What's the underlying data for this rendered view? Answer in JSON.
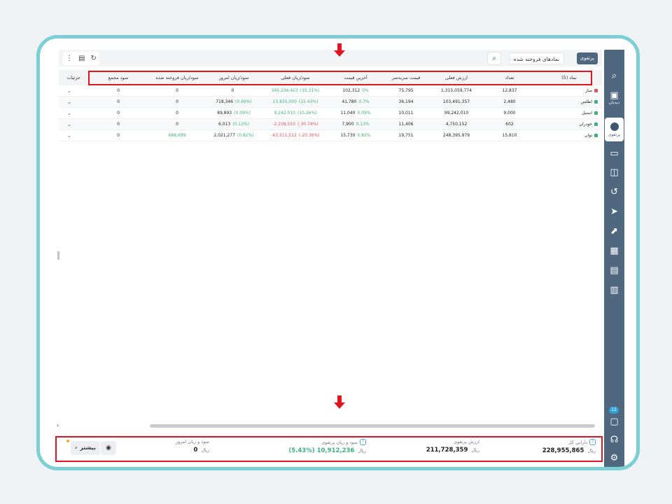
{
  "tabs": {
    "active": "پرتفوی",
    "sold": "نمادهای فروخته شده"
  },
  "sidebar": {
    "items": [
      {
        "icon": "search-icon",
        "label": ""
      },
      {
        "icon": "watchlist-icon",
        "label": "دیدبان"
      },
      {
        "icon": "portfolio-pie-icon",
        "label": "پرتفوی"
      },
      {
        "icon": "opt-icon",
        "label": ""
      },
      {
        "icon": "wallet-icon",
        "label": ""
      },
      {
        "icon": "history-icon",
        "label": ""
      },
      {
        "icon": "send-icon",
        "label": ""
      },
      {
        "icon": "chart-up-icon",
        "label": ""
      },
      {
        "icon": "grid-icon",
        "label": ""
      },
      {
        "icon": "news-icon",
        "label": ""
      },
      {
        "icon": "bars-icon",
        "label": ""
      },
      {
        "icon": "chat-icon",
        "label": ""
      },
      {
        "icon": "support-icon",
        "label": ""
      },
      {
        "icon": "settings-icon",
        "label": ""
      }
    ],
    "chat_badge": "12"
  },
  "table": {
    "headers": {
      "symbol": "نماد (5)",
      "count": "تعداد",
      "current_value": "ارزش فعلی",
      "breakeven": "قیمت سربه‌سر",
      "last_price": "آخرین قیمت",
      "current_pl": "سود/زیان فعلی",
      "today_pl": "سود/زیان امروز",
      "sold_pl": "سود/زیان فروخته شده",
      "total_profit": "سود مجمع",
      "details": "جزئیات"
    },
    "rows": [
      {
        "symbol": "میاز",
        "dot": "#e0515a",
        "count": "12,837",
        "current_value": "1,315,059,774",
        "breakeven": "75,795",
        "last_price": "102,312",
        "last_pct": "0%",
        "current_pl": "345,236,423",
        "current_pct": "(35.31%)",
        "today_pl": "0",
        "today_pct": "",
        "sold_pl": "0",
        "sold_extra": "",
        "total_profit": "0"
      },
      {
        "symbol": "اطلس",
        "dot": "#3db27a",
        "count": "2,480",
        "current_value": "103,491,357",
        "breakeven": "36,194",
        "last_price": "41,780",
        "last_pct": "0.7%",
        "current_pl": "13,835,000",
        "current_pct": "(15.43%)",
        "today_pl": "718,346",
        "today_pct": "(0.69%)",
        "sold_pl": "0",
        "sold_extra": "",
        "total_profit": "0"
      },
      {
        "symbol": "استیل",
        "dot": "#3db27a",
        "count": "9,000",
        "current_value": "99,242,010",
        "breakeven": "10,011",
        "last_price": "11,040",
        "last_pct": "0.09%",
        "current_pl": "9,242,010",
        "current_pct": "(10.26%)",
        "today_pl": "89,893",
        "today_pct": "(0.09%)",
        "sold_pl": "0",
        "sold_extra": "",
        "total_profit": "0"
      },
      {
        "symbol": "خودران",
        "dot": "#3db27a",
        "count": "602",
        "current_value": "4,750,152",
        "breakeven": "11,406",
        "last_price": "7,900",
        "last_pct": "0.13%",
        "current_pl": "-2,108,553",
        "current_pct": "(-30.74%)",
        "today_pl": "6,013",
        "today_pct": "(0.12%)",
        "sold_pl": "0",
        "sold_extra": "",
        "total_profit": "0"
      },
      {
        "symbol": "توان",
        "dot": "#3db27a",
        "count": "15,810",
        "current_value": "248,395,979",
        "breakeven": "19,751",
        "last_price": "15,730",
        "last_pct": "0.82%",
        "current_pl": "-63,511,512",
        "current_pct": "(-20.36%)",
        "today_pl": "2,021,277",
        "today_pct": "(0.82%)",
        "sold_pl": "",
        "sold_extra": "688,699",
        "total_profit": "0"
      }
    ]
  },
  "footer": {
    "total_assets_label": "دارایی کل",
    "total_assets_value": "228,955,865",
    "portfolio_value_label": "ارزش پرتفوی",
    "portfolio_value_value": "211,728,359",
    "portfolio_pl_label": "سود و زیان پرتفوی",
    "portfolio_pl_value": "10,912,236 (%5.43)",
    "today_pl_label": "سود و زیان امروز",
    "today_pl_value": "0",
    "unit": "ریال",
    "more_label": "بیشتر",
    "more_chevron": "›"
  },
  "colors": {
    "sidebar": "#4f6880",
    "highlight": "#e4141e",
    "frame": "#7dcfd6",
    "positive": "#3db27a",
    "negative": "#e0515a"
  }
}
